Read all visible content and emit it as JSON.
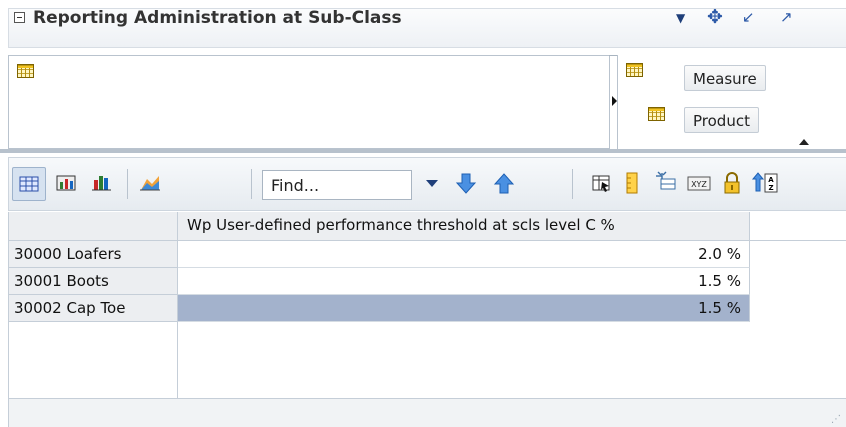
{
  "panel": {
    "title": "Reporting Administration at Sub-Class"
  },
  "layout": {
    "row_items": [
      {
        "label": "Measure",
        "icon": "grid-icon"
      },
      {
        "label": "Product",
        "icon": "grid-icon"
      }
    ]
  },
  "toolbar": {
    "find_placeholder": "Find...",
    "buttons": [
      "table-view",
      "chart-table-view",
      "chart-view",
      "area-chart",
      "move-down",
      "move-up",
      "detach",
      "highlight",
      "freeze",
      "xyz-format",
      "lock",
      "sort-az"
    ]
  },
  "table": {
    "column_header": "Wp User-defined performance threshold at scls level C %",
    "rows": [
      {
        "label": "30000 Loafers",
        "value": "2.0 %",
        "selected": false
      },
      {
        "label": "30001 Boots",
        "value": "1.5 %",
        "selected": false
      },
      {
        "label": "30002 Cap Toe",
        "value": "1.5 %",
        "selected": true
      }
    ]
  },
  "colors": {
    "selected_cell": "#a3b2cc",
    "header_bg": "#eceef1",
    "icon_blue": "#2d6fd6"
  }
}
